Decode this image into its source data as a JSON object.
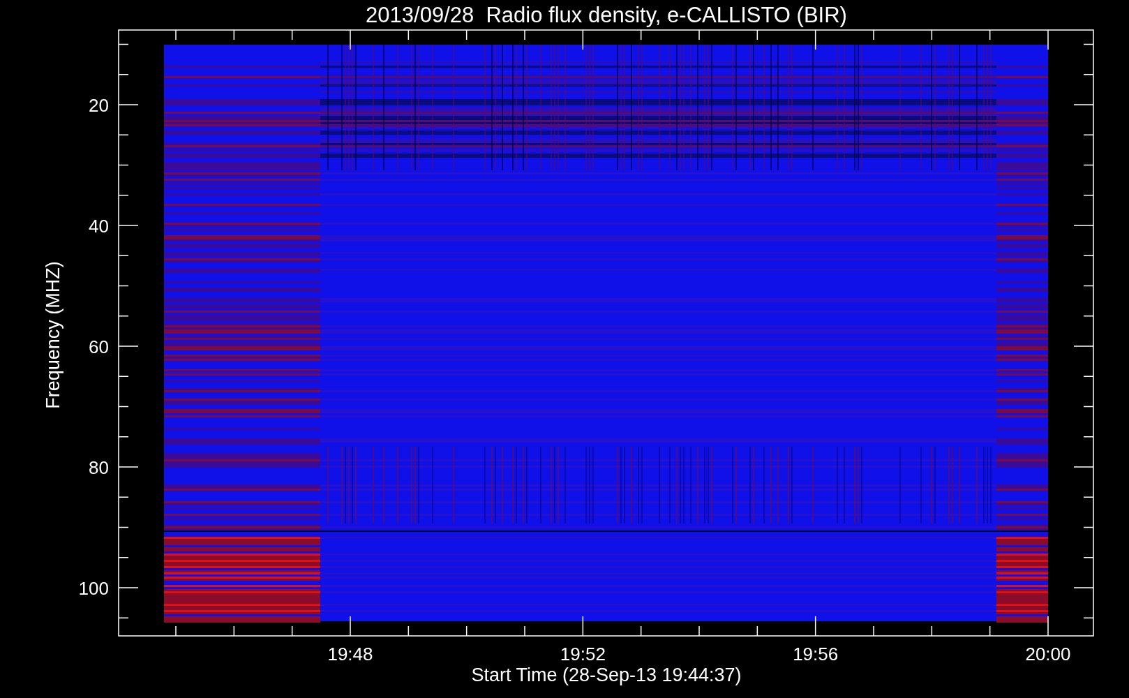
{
  "title": "2013/09/28  Radio flux density, e-CALLISTO (BIR)",
  "ylabel": "Frequency (MHZ)",
  "xlabel": "Start Time (28-Sep-13 19:44:37)",
  "yticks": [
    "20",
    "40",
    "60",
    "80",
    "100"
  ],
  "xticks": [
    "19:48",
    "19:52",
    "19:56",
    "20:00"
  ]
}
